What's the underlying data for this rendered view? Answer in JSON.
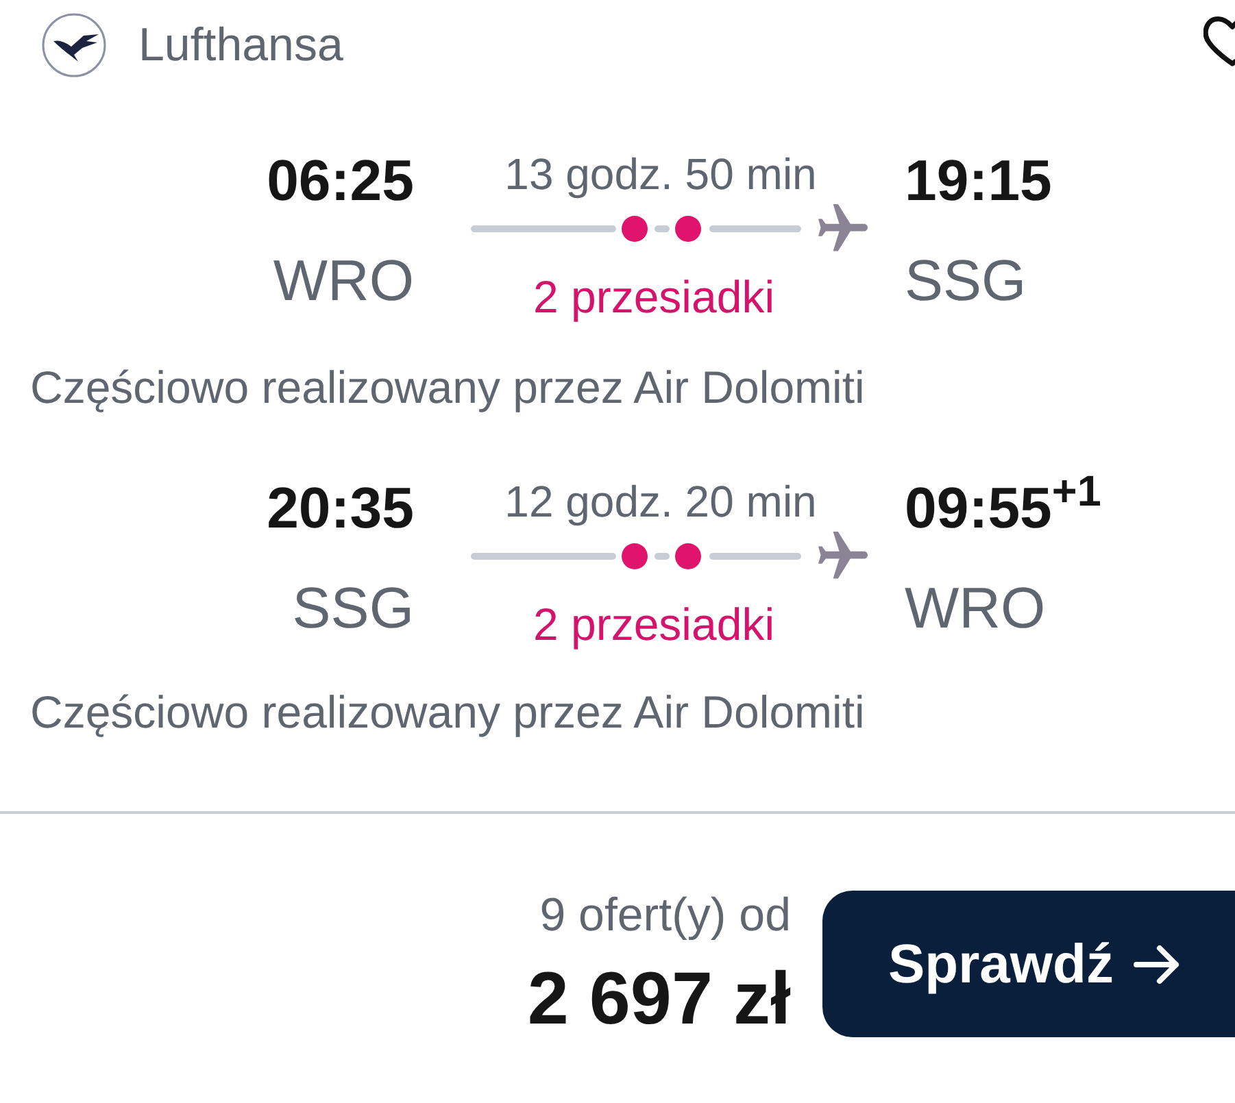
{
  "header": {
    "airline": "Lufthansa",
    "saved": false
  },
  "segments": [
    {
      "departure_time": "06:25",
      "departure_airport": "WRO",
      "duration": "13 godz. 50 min",
      "stops": "2 przesiadki",
      "arrival_time": "19:15",
      "arrival_airport": "SSG",
      "operated_by": "Częściowo realizowany przez Air Dolomiti"
    },
    {
      "departure_time": "20:35",
      "departure_airport": "SSG",
      "duration": "12 godz. 20 min",
      "stops": "2 przesiadki",
      "arrival_time": "09:55$^{+1}$",
      "arrival_airport": "WRO",
      "operated_by": "Częściowo realizowany przez Air Dolomiti"
    }
  ],
  "offer": {
    "count": "9 ofert(y) od",
    "price": "2 697 zł",
    "button": "Sprawdź"
  }
}
